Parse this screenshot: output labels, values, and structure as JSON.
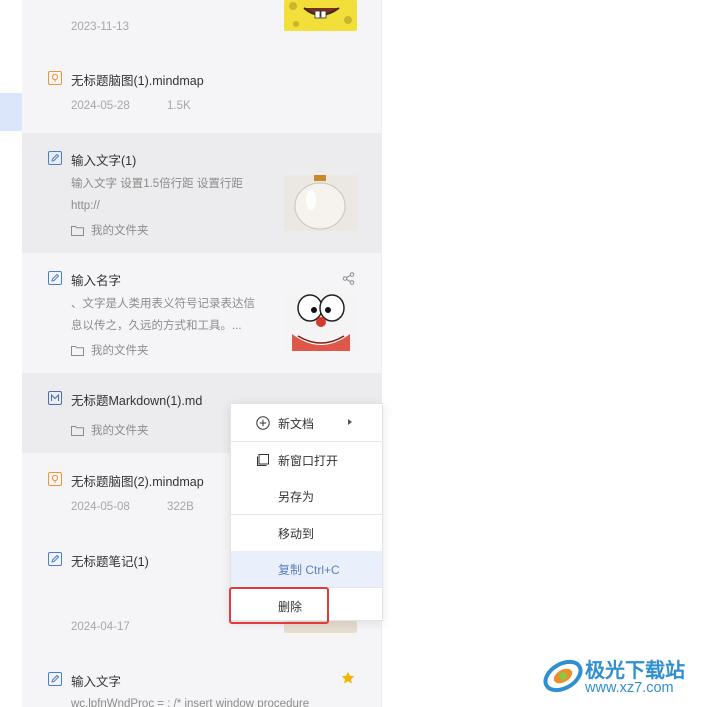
{
  "notes": [
    {
      "type": "image",
      "title": "",
      "date": "2023-11-13",
      "size": ""
    },
    {
      "type": "mindmap",
      "title": "无标题脑图(1).mindmap",
      "date": "2024-05-28",
      "size": "1.5K"
    },
    {
      "type": "note",
      "title": "输入文字(1)",
      "snippet": "输入文字 设置1.5倍行距 设置行距 http://",
      "folder": "我的文件夹"
    },
    {
      "type": "note",
      "title": "输入名字",
      "snippet": "、文字是人类用表义符号记录表达信息以传之，久远的方式和工具。...",
      "folder": "我的文件夹"
    },
    {
      "type": "markdown",
      "title": "无标题Markdown(1).md",
      "folder": "我的文件夹"
    },
    {
      "type": "mindmap",
      "title": "无标题脑图(2).mindmap",
      "date": "2024-05-08",
      "size": "322B"
    },
    {
      "type": "note",
      "title": "无标题笔记(1)",
      "date": "2024-04-17"
    },
    {
      "type": "note",
      "title": "输入文字",
      "snippet": "wc.lpfnWndProc = ; /* insert window procedure"
    }
  ],
  "context_menu": {
    "items": [
      {
        "label": "新文档",
        "has_submenu": true
      },
      {
        "label": "新窗口打开"
      },
      {
        "label": "另存为"
      },
      {
        "label": "移动到"
      },
      {
        "label": "复制 Ctrl+C"
      },
      {
        "label": "删除"
      }
    ]
  },
  "watermark": {
    "title": "极光下载站",
    "url": "www.xz7.com"
  },
  "colors": {
    "accent": "#4a7fd0",
    "highlight_bg": "#e9f0fb",
    "annotation_red": "#e33a3a",
    "star": "#f5b400",
    "watermark": "#2f8fd1"
  }
}
